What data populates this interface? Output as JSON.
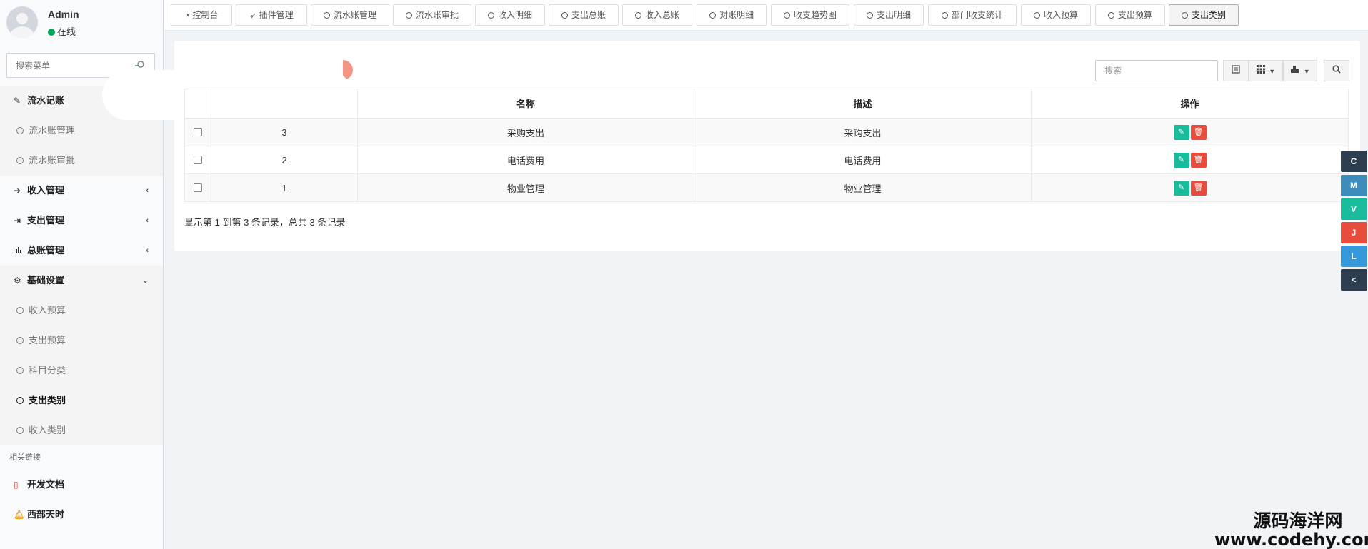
{
  "user": {
    "name": "Admin",
    "status": "在线"
  },
  "sidebar_search": {
    "placeholder": "搜索菜单"
  },
  "menu": {
    "liushui": {
      "label": "流水记账",
      "icon": "edit-icon"
    },
    "liushui_manage": "流水账管理",
    "liushui_review": "流水账审批",
    "income": {
      "label": "收入管理",
      "icon": "sign-in-icon"
    },
    "expense": {
      "label": "支出管理",
      "icon": "sign-out-icon"
    },
    "ledger": {
      "label": "总账管理",
      "icon": "bar-chart-icon"
    },
    "basic": {
      "label": "基础设置",
      "icon": "gear-icon"
    },
    "income_budget": "收入预算",
    "expense_budget": "支出预算",
    "subject_category": "科目分类",
    "expense_category": "支出类别",
    "income_category": "收入类别",
    "links_header": "相关链接",
    "dev_docs": {
      "label": "开发文档",
      "icon": "pdf-icon"
    },
    "west": {
      "label": "西部天时",
      "icon": "bell-icon"
    }
  },
  "tabs": [
    {
      "label": "控制台",
      "icon": "dashboard-icon"
    },
    {
      "label": "插件管理",
      "icon": "rocket-icon"
    },
    {
      "label": "流水账管理"
    },
    {
      "label": "流水账审批"
    },
    {
      "label": "收入明细"
    },
    {
      "label": "支出总账"
    },
    {
      "label": "收入总账"
    },
    {
      "label": "对账明细"
    },
    {
      "label": "收支趋势图"
    },
    {
      "label": "支出明细"
    },
    {
      "label": "部门收支统计"
    },
    {
      "label": "收入预算"
    },
    {
      "label": "支出预算"
    },
    {
      "label": "支出类别",
      "active": true
    }
  ],
  "toolbar": {
    "search_placeholder": "搜索"
  },
  "table": {
    "headers": {
      "name": "名称",
      "desc": "描述",
      "ops": "操作"
    },
    "rows": [
      {
        "id": "3",
        "name": "采购支出",
        "desc": "采购支出"
      },
      {
        "id": "2",
        "name": "电话费用",
        "desc": "电话费用"
      },
      {
        "id": "1",
        "name": "物业管理",
        "desc": "物业管理"
      }
    ]
  },
  "summary": "显示第 1 到第 3 条记录，总共 3 条记录",
  "float_buttons": [
    {
      "label": "C",
      "color": "#2c3e50"
    },
    {
      "label": "M",
      "color": "#3c8dbc"
    },
    {
      "label": "V",
      "color": "#18bc9c"
    },
    {
      "label": "J",
      "color": "#e74c3c"
    },
    {
      "label": "L",
      "color": "#3498db"
    },
    {
      "label": "<",
      "color": "#2c3e50"
    }
  ],
  "watermark": {
    "line1": "源码海洋网",
    "line2": "www.codehy.com"
  }
}
